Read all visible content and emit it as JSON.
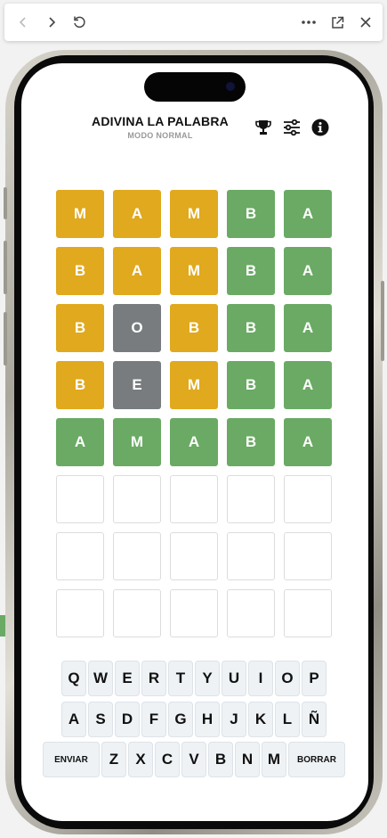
{
  "colors": {
    "correct": "#6aaa64",
    "present": "#e0a91e",
    "absent": "#787c7e",
    "key_bg": "#eef2f5"
  },
  "browser_bar": {
    "icons": [
      "back-icon",
      "forward-icon",
      "reload-icon",
      "more-icon",
      "open-external-icon",
      "close-icon"
    ]
  },
  "header": {
    "title": "ADIVINA LA PALABRA",
    "subtitle": "MODO NORMAL",
    "icons": [
      "trophy-icon",
      "settings-sliders-icon",
      "info-icon"
    ]
  },
  "board": {
    "rows": [
      [
        {
          "l": "M",
          "s": "present"
        },
        {
          "l": "A",
          "s": "present"
        },
        {
          "l": "M",
          "s": "present"
        },
        {
          "l": "B",
          "s": "correct"
        },
        {
          "l": "A",
          "s": "correct"
        }
      ],
      [
        {
          "l": "B",
          "s": "present"
        },
        {
          "l": "A",
          "s": "present"
        },
        {
          "l": "M",
          "s": "present"
        },
        {
          "l": "B",
          "s": "correct"
        },
        {
          "l": "A",
          "s": "correct"
        }
      ],
      [
        {
          "l": "B",
          "s": "present"
        },
        {
          "l": "O",
          "s": "absent"
        },
        {
          "l": "B",
          "s": "present"
        },
        {
          "l": "B",
          "s": "correct"
        },
        {
          "l": "A",
          "s": "correct"
        }
      ],
      [
        {
          "l": "B",
          "s": "present"
        },
        {
          "l": "E",
          "s": "absent"
        },
        {
          "l": "M",
          "s": "present"
        },
        {
          "l": "B",
          "s": "correct"
        },
        {
          "l": "A",
          "s": "correct"
        }
      ],
      [
        {
          "l": "A",
          "s": "correct"
        },
        {
          "l": "M",
          "s": "correct"
        },
        {
          "l": "A",
          "s": "correct"
        },
        {
          "l": "B",
          "s": "correct"
        },
        {
          "l": "A",
          "s": "correct"
        }
      ],
      [
        {
          "l": "",
          "s": "empty"
        },
        {
          "l": "",
          "s": "empty"
        },
        {
          "l": "",
          "s": "empty"
        },
        {
          "l": "",
          "s": "empty"
        },
        {
          "l": "",
          "s": "empty"
        }
      ],
      [
        {
          "l": "",
          "s": "empty"
        },
        {
          "l": "",
          "s": "empty"
        },
        {
          "l": "",
          "s": "empty"
        },
        {
          "l": "",
          "s": "empty"
        },
        {
          "l": "",
          "s": "empty"
        }
      ],
      [
        {
          "l": "",
          "s": "empty"
        },
        {
          "l": "",
          "s": "empty"
        },
        {
          "l": "",
          "s": "empty"
        },
        {
          "l": "",
          "s": "empty"
        },
        {
          "l": "",
          "s": "empty"
        }
      ]
    ]
  },
  "keyboard": {
    "row1": [
      "Q",
      "W",
      "E",
      "R",
      "T",
      "Y",
      "U",
      "I",
      "O",
      "P"
    ],
    "row2": [
      "A",
      "S",
      "D",
      "F",
      "G",
      "H",
      "J",
      "K",
      "L",
      "Ñ"
    ],
    "row3": [
      "Z",
      "X",
      "C",
      "V",
      "B",
      "N",
      "M"
    ],
    "enter_label": "ENVIAR",
    "delete_label": "BORRAR"
  }
}
